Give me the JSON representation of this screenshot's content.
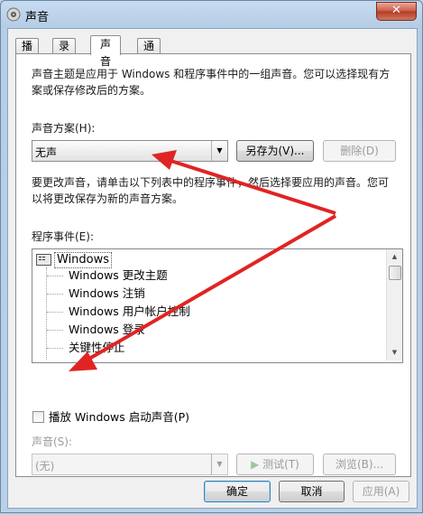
{
  "window": {
    "title": "声音",
    "close_label": "✕"
  },
  "tabs": [
    {
      "label": "播放",
      "active": false
    },
    {
      "label": "录制",
      "active": false
    },
    {
      "label": "声音",
      "active": true
    },
    {
      "label": "通信",
      "active": false
    }
  ],
  "intro_text_line1": "声音主题是应用于 Windows 和程序事件中的一组声音。您可以选择现有方",
  "intro_text_line2": "案或保存修改后的方案。",
  "scheme": {
    "label": "声音方案(H):",
    "value": "无声",
    "save_as_label": "另存为(V)...",
    "delete_label": "删除(D)"
  },
  "instruction_line1": "要更改声音，请单击以下列表中的程序事件，然后选择要应用的声音。您可",
  "instruction_line2": "以将更改保存为新的声音方案。",
  "events": {
    "label": "程序事件(E):",
    "root": "Windows",
    "items": [
      "Windows 更改主题",
      "Windows 注销",
      "Windows 用户帐户控制",
      "Windows 登录",
      "关键性停止"
    ]
  },
  "startup_sound": {
    "label": "播放 Windows 启动声音(P)",
    "checked": false
  },
  "sound": {
    "label": "声音(S):",
    "value": "(无)",
    "test_label": "测试(T)",
    "browse_label": "浏览(B)..."
  },
  "footer": {
    "ok_label": "确定",
    "cancel_label": "取消",
    "apply_label": "应用(A)"
  },
  "colors": {
    "arrow": "#e02424",
    "accent": "#3c7fb1"
  }
}
